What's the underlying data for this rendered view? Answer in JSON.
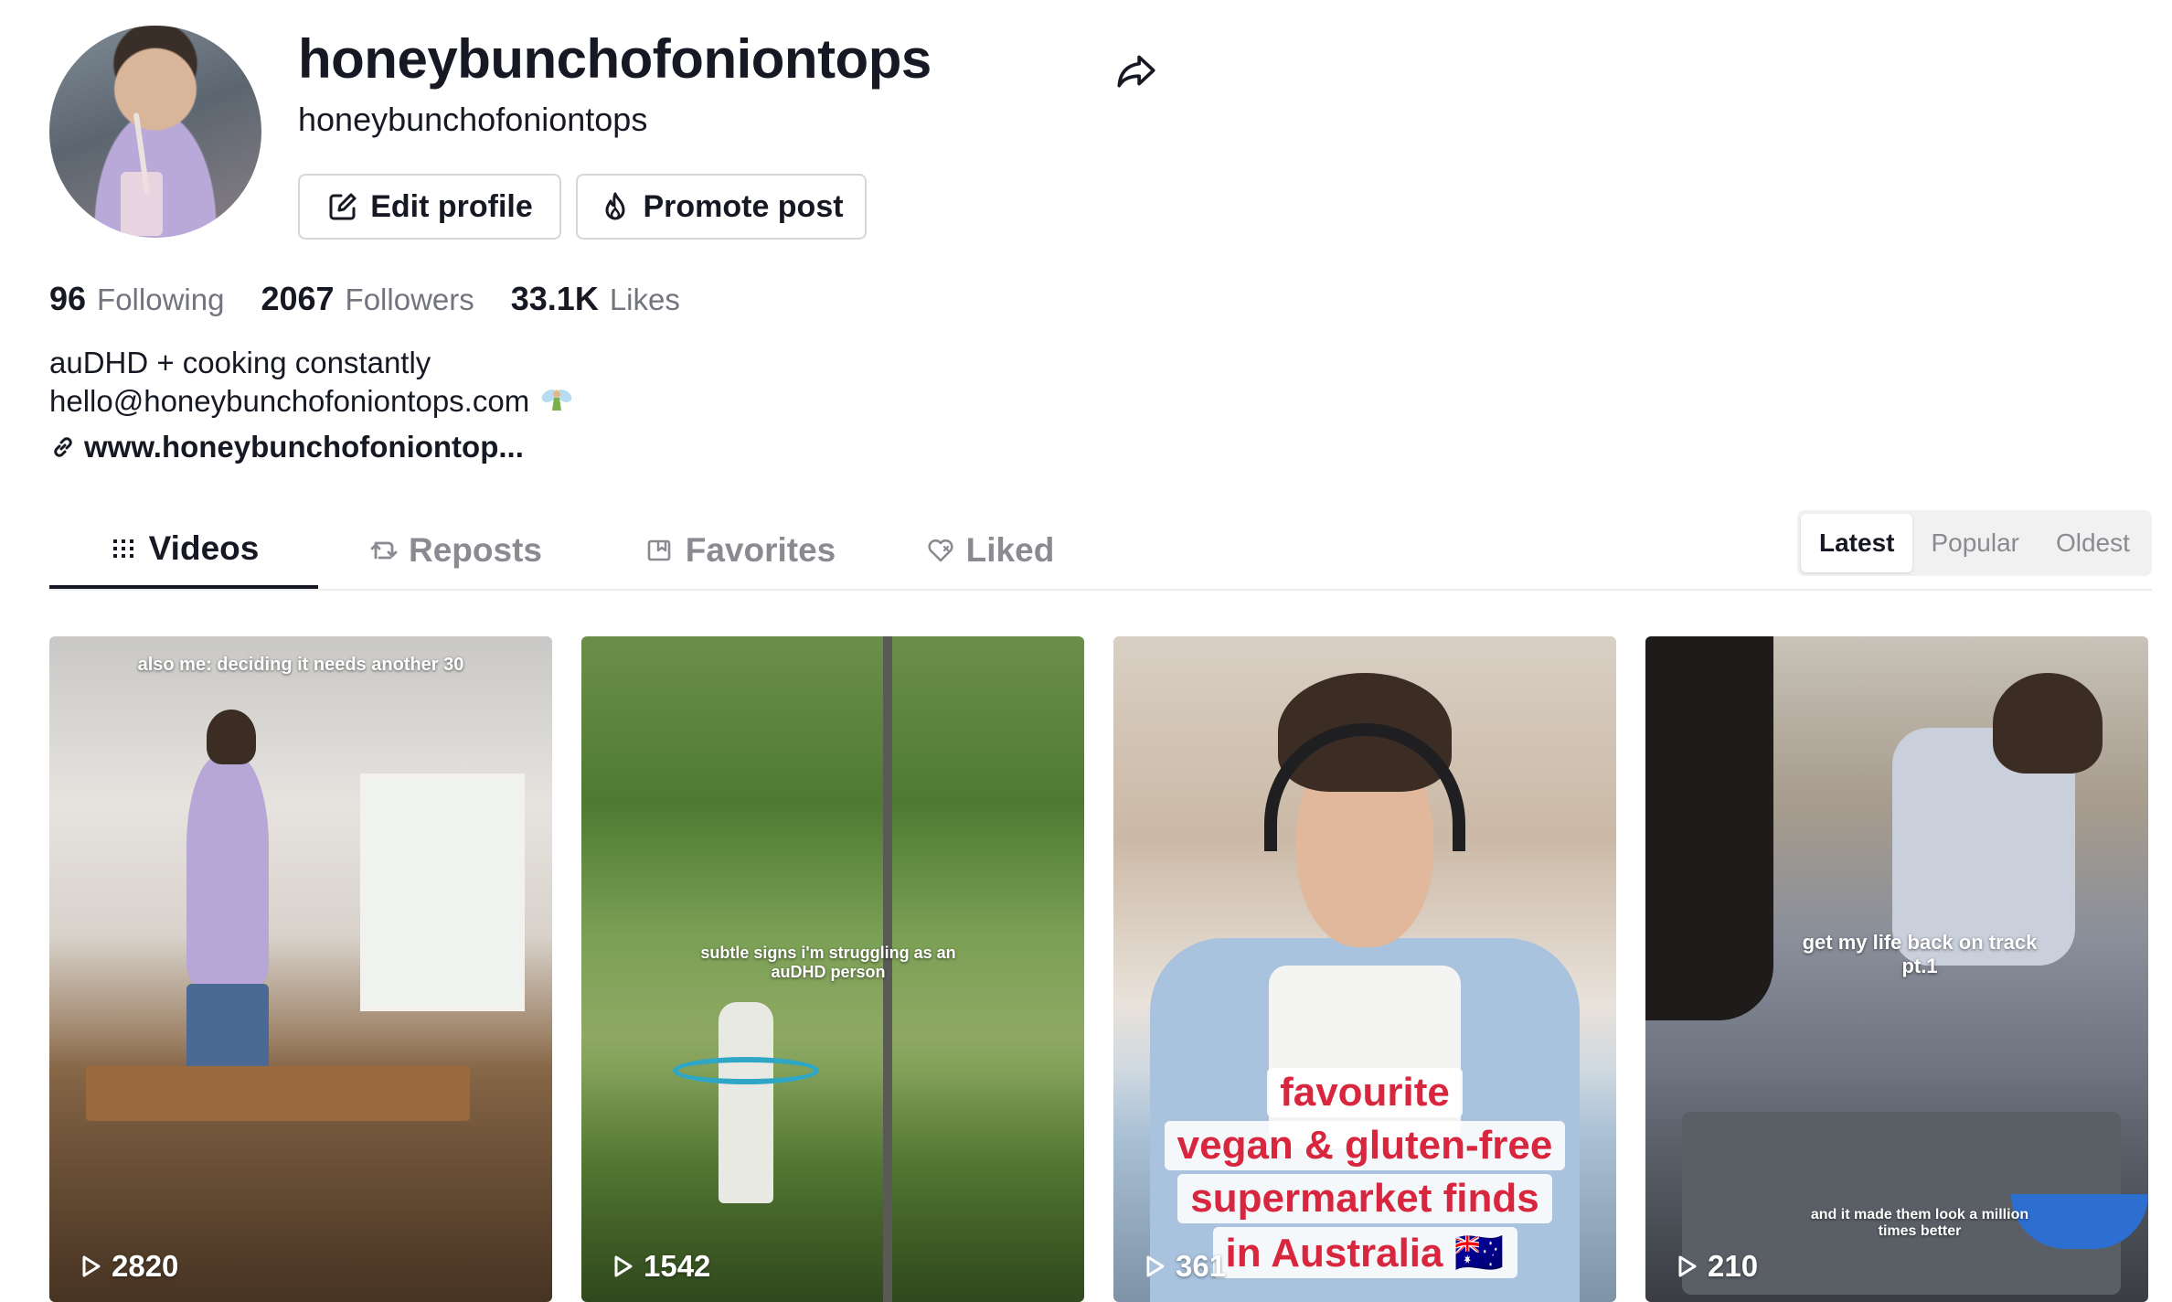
{
  "profile": {
    "username": "honeybunchofoniontops",
    "nickname": "honeybunchofoniontops",
    "avatar_icon": "profile-photo"
  },
  "actions": {
    "edit_label": "Edit profile",
    "edit_icon": "edit-icon",
    "promote_label": "Promote post",
    "promote_icon": "flame-icon",
    "share_icon": "share-icon"
  },
  "stats": [
    {
      "value": "96",
      "label": "Following"
    },
    {
      "value": "2067",
      "label": "Followers"
    },
    {
      "value": "33.1K",
      "label": "Likes"
    }
  ],
  "bio": {
    "line1": "auDHD + cooking constantly",
    "line2": "hello@honeybunchofoniontops.com",
    "line2_emoji": "fairy-emoji",
    "link": "www.honeybunchofoniontop..."
  },
  "tabs": [
    {
      "label": "Videos",
      "icon": "grid-icon",
      "active": true
    },
    {
      "label": "Reposts",
      "icon": "repost-icon",
      "active": false
    },
    {
      "label": "Favorites",
      "icon": "bookmark-icon",
      "active": false
    },
    {
      "label": "Liked",
      "icon": "heart-icon",
      "active": false
    }
  ],
  "sort": [
    {
      "label": "Latest",
      "active": true
    },
    {
      "label": "Popular",
      "active": false
    },
    {
      "label": "Oldest",
      "active": false
    }
  ],
  "videos": [
    {
      "overlay": "also me: deciding it needs another 30",
      "views": "2820"
    },
    {
      "overlay": "subtle signs i'm struggling as an auDHD person",
      "views": "1542"
    },
    {
      "caption_lines": [
        "favourite",
        "vegan & gluten-free",
        "supermarket finds",
        "in Australia 🇦🇺"
      ],
      "views": "361"
    },
    {
      "overlay": "get my life back on track pt.1",
      "overlay2": "and it made them look a million times better",
      "views": "210"
    }
  ],
  "colors": {
    "text": "#161823",
    "muted": "#73757e",
    "border": "#d6d6da",
    "caption_red": "#d7263d"
  }
}
